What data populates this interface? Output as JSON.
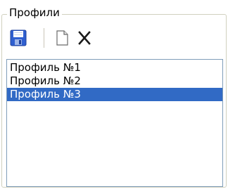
{
  "group": {
    "title": "Профили"
  },
  "toolbar": {
    "buttons": [
      {
        "icon": "save-icon"
      },
      {
        "icon": "new-document-icon"
      },
      {
        "icon": "delete-icon"
      }
    ]
  },
  "profiles": {
    "items": [
      {
        "label": "Профиль №1",
        "selected": false
      },
      {
        "label": "Профиль №2",
        "selected": false
      },
      {
        "label": "Профиль №3",
        "selected": true
      }
    ]
  },
  "colors": {
    "selection": "#316ac5",
    "list_border": "#7f9db9",
    "save_icon": "#2f5fd0"
  }
}
